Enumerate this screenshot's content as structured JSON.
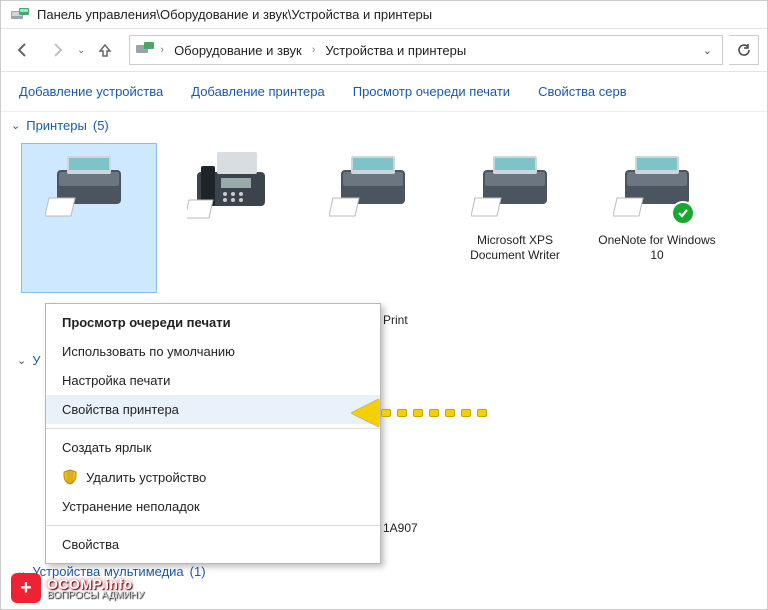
{
  "titlebar": {
    "path": "Панель управления\\Оборудование и звук\\Устройства и принтеры"
  },
  "addrbar": {
    "part1": "Оборудование и звук",
    "part2": "Устройства и принтеры"
  },
  "cmdbar": {
    "addDevice": "Добавление устройства",
    "addPrinter": "Добавление принтера",
    "viewQueue": "Просмотр очереди печати",
    "serverProps": "Свойства серв"
  },
  "groups": {
    "printers": {
      "label": "Принтеры",
      "count": "(5)"
    },
    "hidden": {
      "label": "У"
    },
    "multimedia": {
      "label": "Устройства мультимедиа",
      "count": "(1)"
    }
  },
  "devices": [
    {
      "name": ""
    },
    {
      "name": ""
    },
    {
      "name": ""
    },
    {
      "name": "Microsoft XPS Document Writer"
    },
    {
      "name": "OneNote for Windows 10"
    }
  ],
  "fragments": {
    "printSuffix": "Print",
    "id1a907": "1A907"
  },
  "contextMenu": {
    "viewQueue": "Просмотр очереди печати",
    "setDefault": "Использовать по умолчанию",
    "printSettings": "Настройка печати",
    "printerProps": "Свойства принтера",
    "createShortcut": "Создать ярлык",
    "removeDevice": "Удалить устройство",
    "troubleshoot": "Устранение неполадок",
    "properties": "Свойства"
  },
  "watermark": {
    "site": "OCOMP.info",
    "sub": "ВОПРОСЫ АДМИНУ"
  }
}
